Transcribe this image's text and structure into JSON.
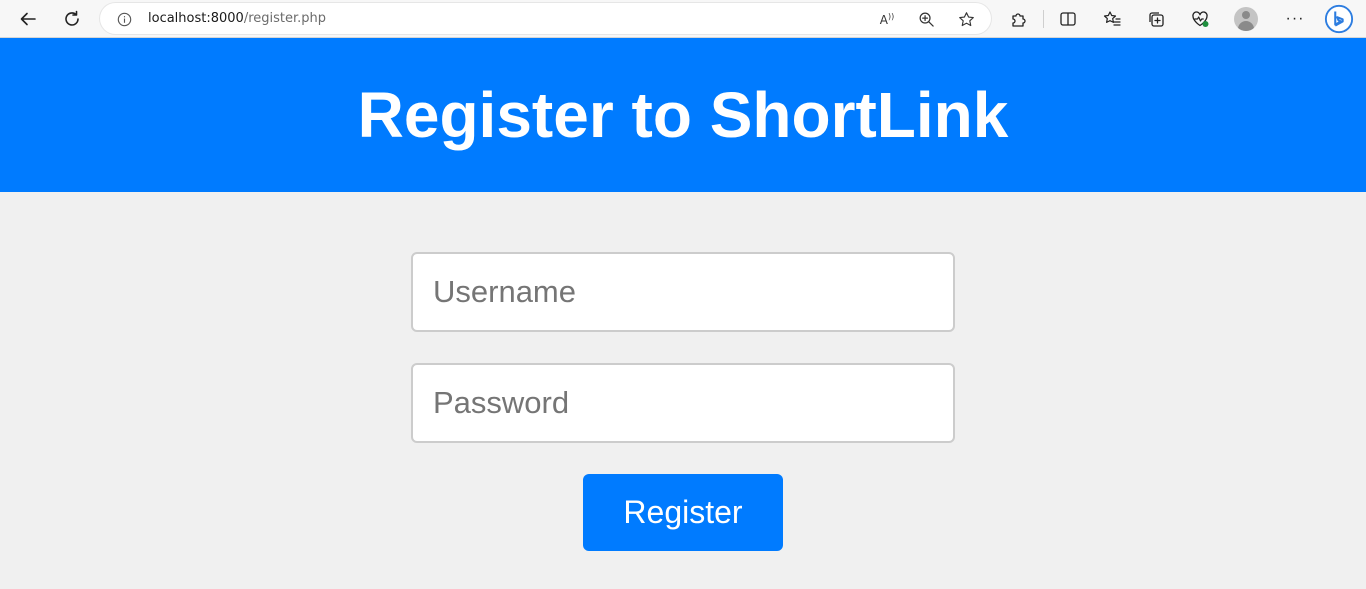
{
  "browser": {
    "url_host": "localhost:8000",
    "url_path": "/register.php",
    "read_aloud_label": "A",
    "icons": {
      "back": "back-arrow-icon",
      "refresh": "refresh-icon",
      "site_info": "info-icon",
      "read_aloud": "read-aloud-icon",
      "zoom": "zoom-icon",
      "favorite": "star-icon",
      "extensions": "puzzle-icon",
      "split_screen": "split-screen-icon",
      "favorites": "favorites-icon",
      "collections": "collections-icon",
      "performance": "heart-pulse-icon",
      "profile": "avatar-icon",
      "more": "more-icon",
      "copilot": "bing-icon"
    },
    "more_label": "···"
  },
  "header": {
    "title": "Register to ShortLink",
    "background": "#007bff"
  },
  "form": {
    "username_placeholder": "Username",
    "username_value": "",
    "password_placeholder": "Password",
    "password_value": "",
    "submit_label": "Register"
  },
  "colors": {
    "accent": "#007bff",
    "page_bg": "#f0f0f0"
  }
}
